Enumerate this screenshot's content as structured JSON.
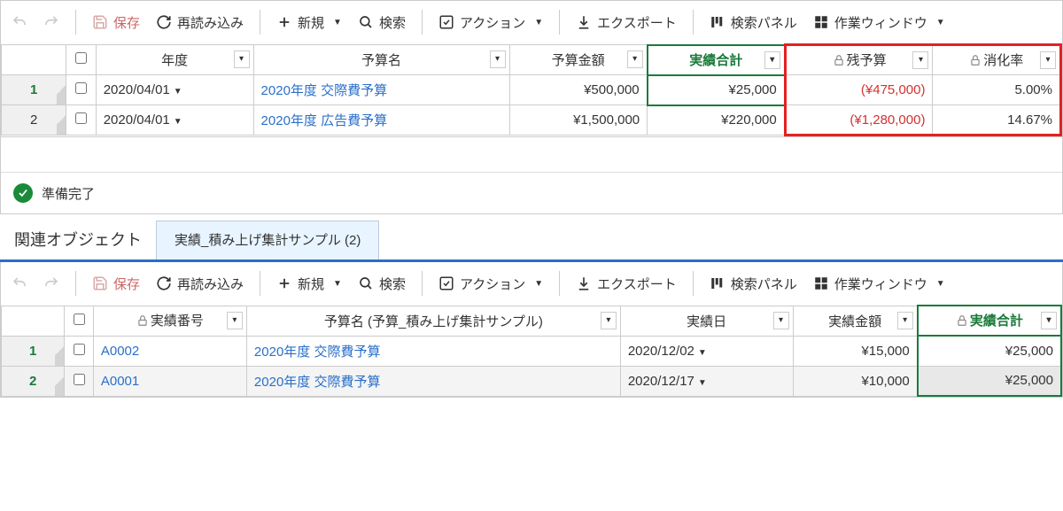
{
  "toolbar": {
    "save": "保存",
    "reload": "再読み込み",
    "new": "新規",
    "search": "検索",
    "action": "アクション",
    "export": "エクスポート",
    "searchPanel": "検索パネル",
    "workWindow": "作業ウィンドウ"
  },
  "topGrid": {
    "headers": {
      "year": "年度",
      "budgetName": "予算名",
      "budgetAmount": "予算金額",
      "actualTotal": "実績合計",
      "remaining": "残予算",
      "usageRate": "消化率"
    },
    "rows": [
      {
        "n": "1",
        "year": "2020/04/01",
        "name": "2020年度 交際費予算",
        "amount": "¥500,000",
        "actual": "¥25,000",
        "remain": "(¥475,000)",
        "rate": "5.00%"
      },
      {
        "n": "2",
        "year": "2020/04/01",
        "name": "2020年度 広告費予算",
        "amount": "¥1,500,000",
        "actual": "¥220,000",
        "remain": "(¥1,280,000)",
        "rate": "14.67%"
      }
    ]
  },
  "status": "準備完了",
  "related": {
    "title": "関連オブジェクト",
    "tab": "実績_積み上げ集計サンプル (2)"
  },
  "bottomGrid": {
    "headers": {
      "actualNo": "実績番号",
      "budgetName": "予算名 (予算_積み上げ集計サンプル)",
      "actualDate": "実績日",
      "actualAmount": "実績金額",
      "actualTotal": "実績合計"
    },
    "rows": [
      {
        "n": "1",
        "no": "A0002",
        "name": "2020年度 交際費予算",
        "date": "2020/12/02",
        "amount": "¥15,000",
        "total": "¥25,000"
      },
      {
        "n": "2",
        "no": "A0001",
        "name": "2020年度 交際費予算",
        "date": "2020/12/17",
        "amount": "¥10,000",
        "total": "¥25,000"
      }
    ]
  },
  "chart_data": {
    "type": "table",
    "tables": [
      {
        "title": "予算",
        "columns": [
          "年度",
          "予算名",
          "予算金額",
          "実績合計",
          "残予算",
          "消化率"
        ],
        "rows": [
          [
            "2020/04/01",
            "2020年度 交際費予算",
            500000,
            25000,
            -475000,
            5.0
          ],
          [
            "2020/04/01",
            "2020年度 広告費予算",
            1500000,
            220000,
            -1280000,
            14.67
          ]
        ]
      },
      {
        "title": "実績_積み上げ集計サンプル",
        "columns": [
          "実績番号",
          "予算名",
          "実績日",
          "実績金額",
          "実績合計"
        ],
        "rows": [
          [
            "A0002",
            "2020年度 交際費予算",
            "2020/12/02",
            15000,
            25000
          ],
          [
            "A0001",
            "2020年度 交際費予算",
            "2020/12/17",
            10000,
            25000
          ]
        ]
      }
    ]
  }
}
